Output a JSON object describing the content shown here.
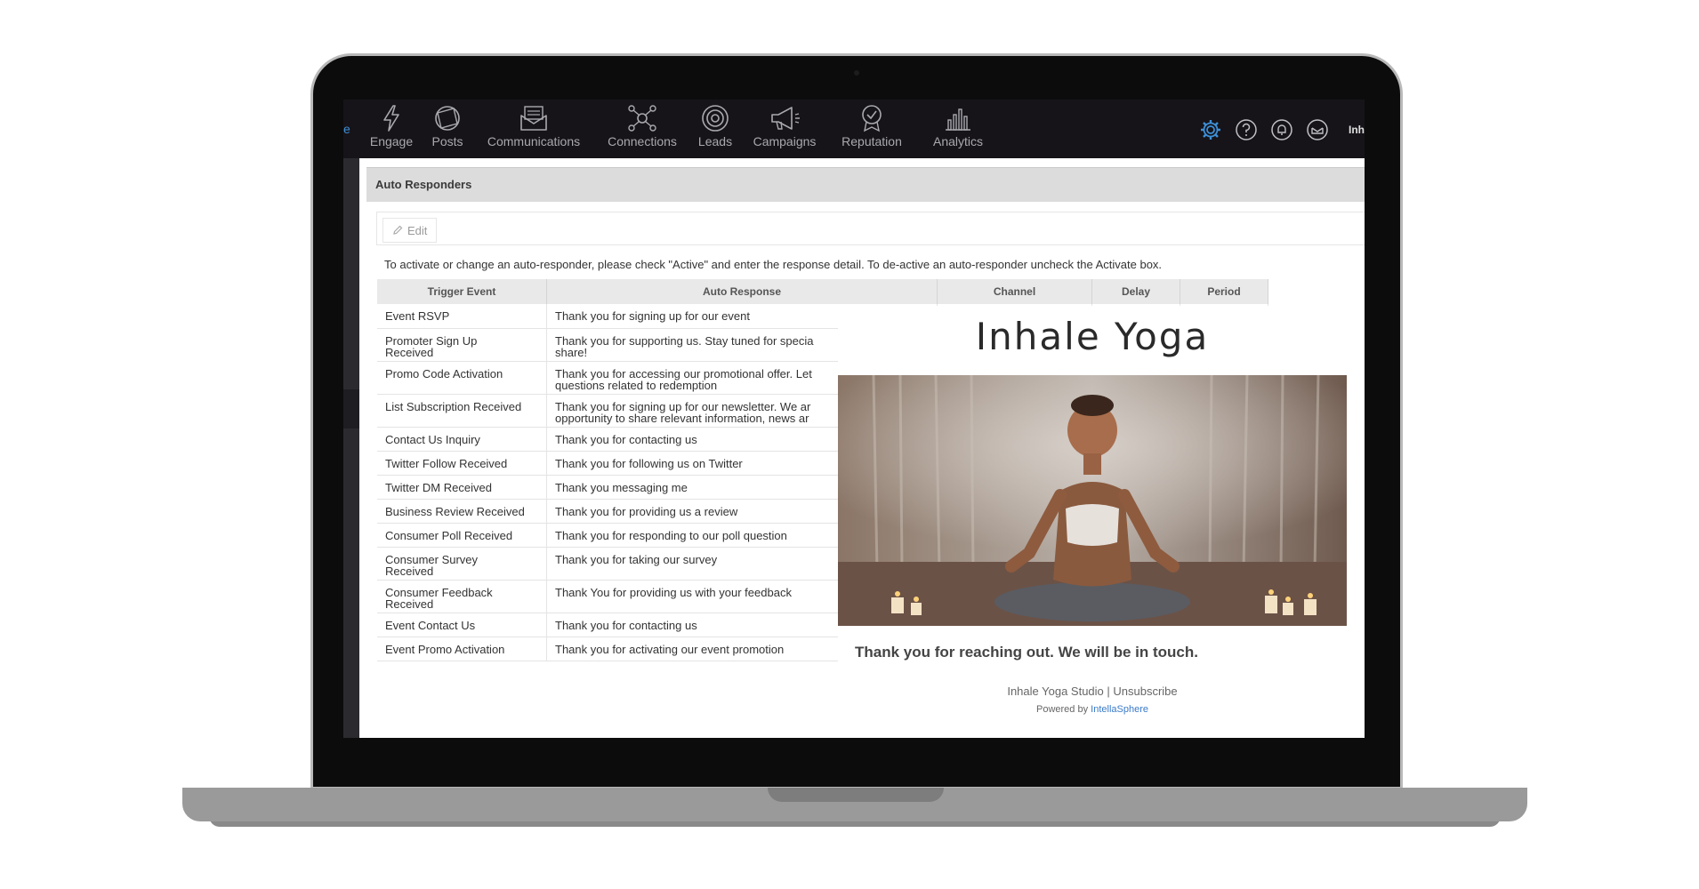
{
  "nav": {
    "left_fragment": "e",
    "items": [
      {
        "label": "Engage",
        "icon": "lightning-icon"
      },
      {
        "label": "Posts",
        "icon": "posts-icon"
      },
      {
        "label": "Communications",
        "icon": "envelope-icon"
      },
      {
        "label": "Connections",
        "icon": "network-icon"
      },
      {
        "label": "Leads",
        "icon": "target-icon"
      },
      {
        "label": "Campaigns",
        "icon": "megaphone-icon"
      },
      {
        "label": "Reputation",
        "icon": "badge-icon"
      },
      {
        "label": "Analytics",
        "icon": "bar-chart-icon"
      }
    ],
    "right_icons": [
      "gear-icon",
      "help-icon",
      "bell-icon",
      "inbox-icon"
    ],
    "user_fragment": "Inh",
    "accent": "#3d8fd6"
  },
  "panel": {
    "title": "Auto Responders",
    "edit_label": "Edit",
    "info": "To activate or change an auto-responder, please check \"Active\" and enter the response detail. To de-active an auto-responder uncheck the Activate box."
  },
  "table": {
    "headers": [
      "Trigger Event",
      "Auto Response",
      "Channel",
      "Delay",
      "Period"
    ],
    "rows": [
      {
        "trigger": "Event RSVP",
        "trigger2": "",
        "response": "Thank you for signing up for our event",
        "response2": ""
      },
      {
        "trigger": "Promoter Sign Up",
        "trigger2": "Received",
        "response": "Thank you for supporting us. Stay tuned for specia",
        "response2": "share!"
      },
      {
        "trigger": "Promo Code Activation",
        "trigger2": "",
        "response": "Thank you for accessing our promotional offer. Let",
        "response2": "questions related to redemption"
      },
      {
        "trigger": "List Subscription Received",
        "trigger2": "",
        "response": "Thank you for signing up for our newsletter. We ar",
        "response2": "opportunity to share relevant information, news ar"
      },
      {
        "trigger": "Contact Us Inquiry",
        "trigger2": "",
        "response": "Thank you for contacting us",
        "response2": ""
      },
      {
        "trigger": "Twitter Follow Received",
        "trigger2": "",
        "response": "Thank you for following us on Twitter",
        "response2": ""
      },
      {
        "trigger": "Twitter DM Received",
        "trigger2": "",
        "response": "Thank you messaging me",
        "response2": ""
      },
      {
        "trigger": "Business Review Received",
        "trigger2": "",
        "response": "Thank you for providing us a review",
        "response2": ""
      },
      {
        "trigger": "Consumer Poll Received",
        "trigger2": "",
        "response": "Thank you for responding to our poll question",
        "response2": ""
      },
      {
        "trigger": "Consumer Survey",
        "trigger2": "Received",
        "response": "Thank you for taking our survey",
        "response2": ""
      },
      {
        "trigger": "Consumer Feedback",
        "trigger2": "Received",
        "response": "Thank You for providing us with your feedback",
        "response2": ""
      },
      {
        "trigger": "Event Contact Us",
        "trigger2": "",
        "response": "Thank you for contacting us",
        "response2": ""
      },
      {
        "trigger": "Event Promo Activation",
        "trigger2": "",
        "response": "Thank you for activating our event promotion",
        "response2": ""
      }
    ]
  },
  "preview": {
    "title": "Inhale Yoga",
    "message": "Thank you for reaching out. We will be in touch.",
    "footer": "Inhale Yoga Studio | Unsubscribe",
    "powered_prefix": "Powered by",
    "powered_link": "IntellaSphere"
  }
}
